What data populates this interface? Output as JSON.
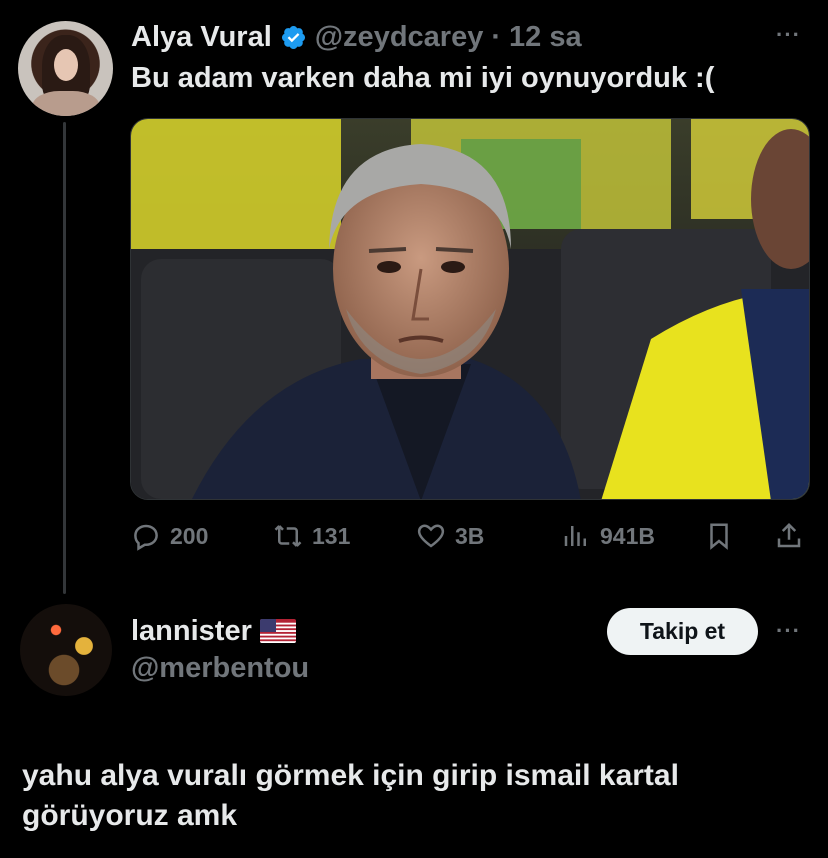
{
  "tweet": {
    "author_name": "Alya Vural",
    "author_handle": "@zeydcarey",
    "time": "· 12 sa",
    "text": "Bu adam varken daha mi iyi oynuyorduk :(",
    "more_label": "···",
    "stats": {
      "replies": "200",
      "reposts": "131",
      "likes": "3B",
      "views": "941B"
    }
  },
  "reply": {
    "author_name": "lannister",
    "author_handle": "@merbentou",
    "flag_icon": "us-flag-icon",
    "follow_label": "Takip et",
    "more_label": "···",
    "text": "yahu alya vuralı görmek için girip ismail kartal görüyoruz amk"
  },
  "colors": {
    "background": "#000000",
    "text_primary": "#e7e9ea",
    "text_secondary": "#71767b",
    "verified": "#1d9bf0",
    "thread_line": "#333639",
    "button_bg": "#eff3f4"
  }
}
